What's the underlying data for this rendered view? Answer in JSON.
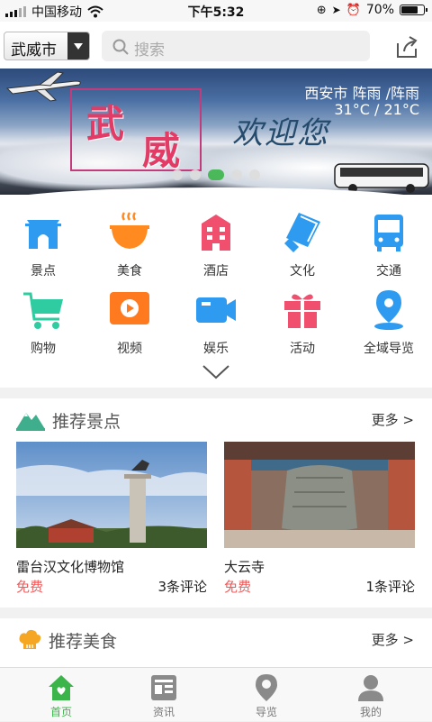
{
  "status_bar": {
    "carrier": "中国移动",
    "time": "下午5:32",
    "battery": "70%"
  },
  "header": {
    "city": "武威市",
    "search_placeholder": "搜索"
  },
  "banner": {
    "title_chars": [
      "武",
      "威"
    ],
    "welcome": "欢迎您",
    "weather_line1": "西安市  阵雨 /阵雨",
    "weather_line2": "31°C / 21°C",
    "dots": 5,
    "active_dot": 2
  },
  "categories": [
    {
      "label": "景点",
      "icon": "gate-icon",
      "color": "#2e9bf0"
    },
    {
      "label": "美食",
      "icon": "bowl-icon",
      "color": "#ff8a1f"
    },
    {
      "label": "酒店",
      "icon": "hotel-icon",
      "color": "#f0506e"
    },
    {
      "label": "文化",
      "icon": "book-icon",
      "color": "#2e9bf0"
    },
    {
      "label": "交通",
      "icon": "bus-icon",
      "color": "#2e9bf0"
    },
    {
      "label": "购物",
      "icon": "cart-icon",
      "color": "#2ecca0"
    },
    {
      "label": "视频",
      "icon": "video-icon",
      "color": "#ff7a1f"
    },
    {
      "label": "娱乐",
      "icon": "camera-icon",
      "color": "#2e9bf0"
    },
    {
      "label": "活动",
      "icon": "gift-icon",
      "color": "#f0506e"
    },
    {
      "label": "全域导览",
      "icon": "location-icon",
      "color": "#2e9bf0"
    }
  ],
  "recommend_spots": {
    "title": "推荐景点",
    "more": "更多 >",
    "items": [
      {
        "name": "雷台汉文化博物馆",
        "price": "免费",
        "comments": "3条评论"
      },
      {
        "name": "大云寺",
        "price": "免费",
        "comments": "1条评论"
      }
    ]
  },
  "recommend_food": {
    "title": "推荐美食",
    "more": "更多 >"
  },
  "tabs": [
    {
      "label": "首页",
      "icon": "home-icon",
      "active": true
    },
    {
      "label": "资讯",
      "icon": "news-icon",
      "active": false
    },
    {
      "label": "导览",
      "icon": "map-pin-icon",
      "active": false
    },
    {
      "label": "我的",
      "icon": "user-icon",
      "active": false
    }
  ],
  "colors": {
    "accent": "#3bb54a",
    "price": "#ef5b5b"
  }
}
